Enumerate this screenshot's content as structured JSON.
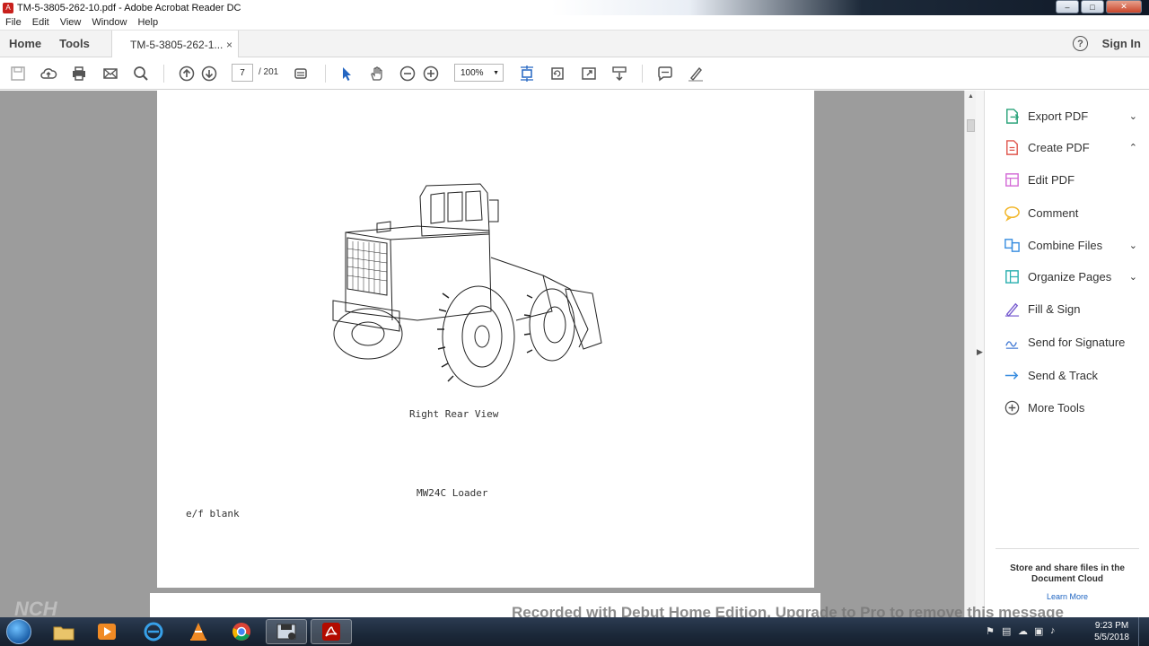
{
  "window": {
    "title": "TM-5-3805-262-10.pdf - Adobe Acrobat Reader DC",
    "controls": {
      "minimize": "‒",
      "maximize": "□",
      "close": "✕"
    }
  },
  "menu": [
    "File",
    "Edit",
    "View",
    "Window",
    "Help"
  ],
  "header": {
    "home": "Home",
    "tools": "Tools",
    "doc_tab": "TM-5-3805-262-1...",
    "tab_close": "×",
    "help": "?",
    "sign_in": "Sign In"
  },
  "toolbar": {
    "page_current": "7",
    "page_total": "/ 201",
    "zoom": "100%",
    "zoom_caret": "▼"
  },
  "document": {
    "figure_caption": "Right Rear View",
    "model_caption": "MW24C Loader",
    "note": "e/f blank"
  },
  "right_panel": {
    "items": [
      {
        "label": "Export PDF",
        "icon": "export-pdf-icon",
        "chevron": "⌄",
        "color": "#2aa37a"
      },
      {
        "label": "Create PDF",
        "icon": "create-pdf-icon",
        "chevron": "⌃",
        "color": "#e0584f"
      },
      {
        "label": "Edit PDF",
        "icon": "edit-pdf-icon",
        "chevron": "",
        "color": "#d36ad6"
      },
      {
        "label": "Comment",
        "icon": "comment-icon",
        "chevron": "",
        "color": "#f2b72c"
      },
      {
        "label": "Combine Files",
        "icon": "combine-files-icon",
        "chevron": "⌄",
        "color": "#3a8ee0"
      },
      {
        "label": "Organize Pages",
        "icon": "organize-pages-icon",
        "chevron": "⌄",
        "color": "#2bb0b0"
      },
      {
        "label": "Fill & Sign",
        "icon": "fill-sign-icon",
        "chevron": "",
        "color": "#7a5fd0"
      },
      {
        "label": "Send for Signature",
        "icon": "send-signature-icon",
        "chevron": "",
        "color": "#4a7fd6"
      },
      {
        "label": "Send & Track",
        "icon": "send-track-icon",
        "chevron": "",
        "color": "#3a8ee0"
      },
      {
        "label": "More Tools",
        "icon": "more-tools-icon",
        "chevron": "",
        "color": "#555555"
      }
    ],
    "cloud_text": "Store and share files in the Document Cloud",
    "learn_more": "Learn More"
  },
  "watermark": {
    "text": "Recorded with Debut Home Edition. Upgrade to Pro to remove this message",
    "logo": "NCH"
  },
  "taskbar": {
    "time": "9:23 PM",
    "date": "5/5/2018"
  }
}
